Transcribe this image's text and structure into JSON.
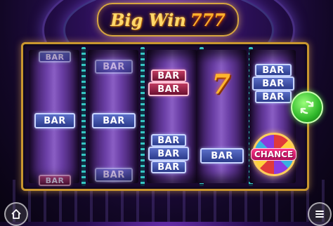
{
  "game": {
    "title_text": "Big Win",
    "title_sevens": "777"
  },
  "reels": {
    "r1": {
      "top": "BAR",
      "mid": "BAR",
      "bottom": "BAR"
    },
    "r2": {
      "top": "BAR",
      "mid": "BAR",
      "bottom": "BAR"
    },
    "r3": {
      "top1": "BAR",
      "top2": "BAR",
      "bot1": "BAR",
      "bot2": "BAR",
      "bot3": "BAR"
    },
    "r4": {
      "seven": "7",
      "mid": "BAR"
    },
    "r5": {
      "top1": "BAR",
      "top2": "BAR",
      "top3": "BAR",
      "chance": "CHANCE"
    }
  },
  "controls": {
    "spin_icon": "spin-arrows-icon",
    "home_icon": "home-icon",
    "menu_icon": "menu-icon"
  },
  "colors": {
    "frame_gold": "#c9962f",
    "spin_green": "#2fb82a",
    "bar_blue": "#2a3a8a",
    "bar_red": "#6a1030"
  }
}
